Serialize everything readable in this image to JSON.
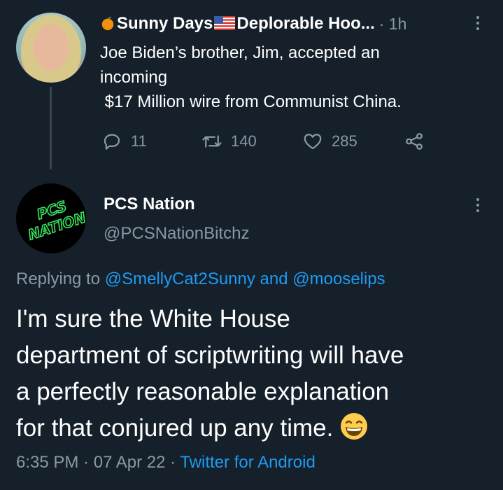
{
  "parent_tweet": {
    "author_name": "Sunny Days",
    "author_name_rest": "Deplorable Hoo...",
    "time": "· 1h",
    "text_lines": [
      "Joe Biden’s brother, Jim, accepted an",
      "incoming",
      " $17 Million wire from Communist China."
    ],
    "reply_count": "11",
    "retweet_count": "140",
    "like_count": "285"
  },
  "reply_tweet": {
    "avatar_text_line1": "PCS",
    "avatar_text_line2": "NATION",
    "author_name": "PCS Nation",
    "handle": "@PCSNationBitchz",
    "replying_prefix": "Replying to ",
    "replying_user1": "@SmellyCat2Sunny",
    "replying_and": " and ",
    "replying_user2": "@mooselips",
    "text_lines": [
      "I'm sure the White House",
      "department of scriptwriting will have",
      "a perfectly reasonable explanation",
      "for that conjured up any time."
    ],
    "time": "6:35 PM",
    "sep1": " · ",
    "date": "07 Apr 22",
    "sep2": " · ",
    "source": "Twitter for Android"
  },
  "colors": {
    "background": "#15202b",
    "text_primary": "#ffffff",
    "text_secondary": "#8899a6",
    "link": "#1d9bf0",
    "avatar_text": "#39e75f"
  },
  "icons": [
    "orange-emoji-icon",
    "us-flag-icon",
    "reply-icon",
    "retweet-icon",
    "like-icon",
    "share-icon",
    "more-options-icon",
    "grinning-face-emoji-icon"
  ]
}
